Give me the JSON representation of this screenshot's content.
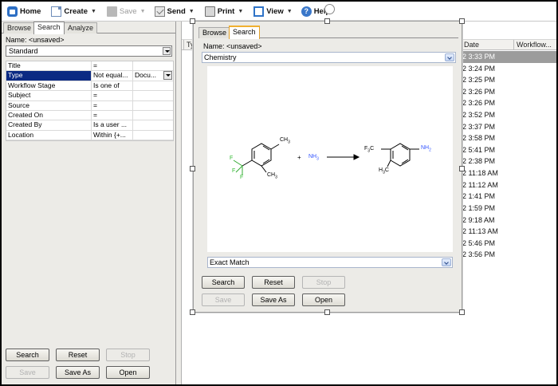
{
  "toolbar": {
    "home": "Home",
    "create": "Create",
    "save": "Save",
    "send": "Send",
    "print": "Print",
    "view": "View",
    "help": "Help"
  },
  "left_panel": {
    "tabs": [
      "Browse",
      "Search",
      "Analyze"
    ],
    "name_label": "Name: <unsaved>",
    "form_select": "Standard",
    "rows": [
      {
        "field": "Title",
        "op": "=",
        "value": ""
      },
      {
        "field": "Type",
        "op": "Not equal...",
        "value": "Docu..."
      },
      {
        "field": "Workflow Stage",
        "op": "Is one of",
        "value": ""
      },
      {
        "field": "Subject",
        "op": "=",
        "value": ""
      },
      {
        "field": "Source",
        "op": "=",
        "value": ""
      },
      {
        "field": "Created On",
        "op": "=",
        "value": ""
      },
      {
        "field": "Created By",
        "op": "Is a user ...",
        "value": ""
      },
      {
        "field": "Location",
        "op": "Within {+...",
        "value": ""
      }
    ],
    "buttons": {
      "search": "Search",
      "reset": "Reset",
      "stop": "Stop",
      "save": "Save",
      "save_as": "Save As",
      "open": "Open"
    }
  },
  "results": {
    "columns": [
      "Ty",
      "Date",
      "Workflow..."
    ],
    "dates": [
      "2 3:33 PM",
      "2 3:24 PM",
      "2 3:25 PM",
      "2 3:26 PM",
      "2 3:26 PM",
      "2 3:52 PM",
      "2 3:37 PM",
      "2 3:58 PM",
      "2 5:41 PM",
      "2 2:38 PM",
      "2 11:18 AM",
      "2 11:12 AM",
      "2 1:41 PM",
      "2 1:59 PM",
      "2 9:18 AM",
      "2 11:13 AM",
      "2 5:46 PM",
      "2 3:56 PM"
    ]
  },
  "popup": {
    "tabs": [
      "Browse",
      "Search"
    ],
    "name_label": "Name: <unsaved>",
    "form_select": "Chemistry",
    "match_select": "Exact Match",
    "buttons": {
      "search": "Search",
      "reset": "Reset",
      "stop": "Stop",
      "save": "Save",
      "save_as": "Save As",
      "open": "Open"
    },
    "structure_labels": {
      "ch3_top": "CH",
      "sub3": "3",
      "f": "F",
      "ch3_bottom": "CH",
      "plus": "+",
      "nh": "NH",
      "f3c": "F",
      "f3c_rest": "C",
      "h3c_h": "H",
      "h3c_c": "C",
      "nh2": "NH"
    },
    "colors": {
      "nitrogen": "#3355ff",
      "fluorine": "#33bb33"
    }
  }
}
